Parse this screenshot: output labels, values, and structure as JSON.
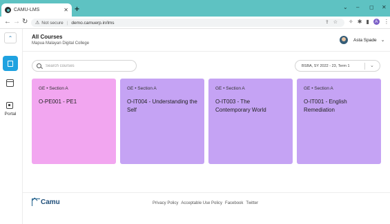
{
  "browser": {
    "tab_title": "CAMU-LMS",
    "tab_close": "✕",
    "new_tab": "+",
    "security": "Not secure",
    "url": "demo.camuerp.in/lms",
    "profile_initial": "A"
  },
  "sidebar": {
    "portal_label": "Portal"
  },
  "header": {
    "title": "All Courses",
    "subtitle": "Mapua Malayan Digital College",
    "user_name": "Asta Spade"
  },
  "search": {
    "placeholder": "Search courses"
  },
  "term_select": {
    "value": "BSBA, SY 2022 - 23, Term 1"
  },
  "courses": [
    {
      "tag": "GE • Section A",
      "title": "O-PE001 - PE1",
      "color": "#f2a6f0"
    },
    {
      "tag": "GE • Section A",
      "title": "O-IT004 - Understanding the Self",
      "color": "#c5a3f4"
    },
    {
      "tag": "GE • Section A",
      "title": "O-IT003 - The Contemporary World",
      "color": "#c5a3f4"
    },
    {
      "tag": "GE • Section A",
      "title": "O-IT001 - English Remediation",
      "color": "#c5a3f4"
    }
  ],
  "footer": {
    "logo_text": "Camu",
    "links": [
      "Privacy Policy",
      "Acceptable Use Policy",
      "Facebook",
      "Twitter"
    ]
  },
  "colors": {
    "accent": "#1fa2e0",
    "tabbar": "#5ec2c2",
    "brand": "#1f4e79"
  }
}
